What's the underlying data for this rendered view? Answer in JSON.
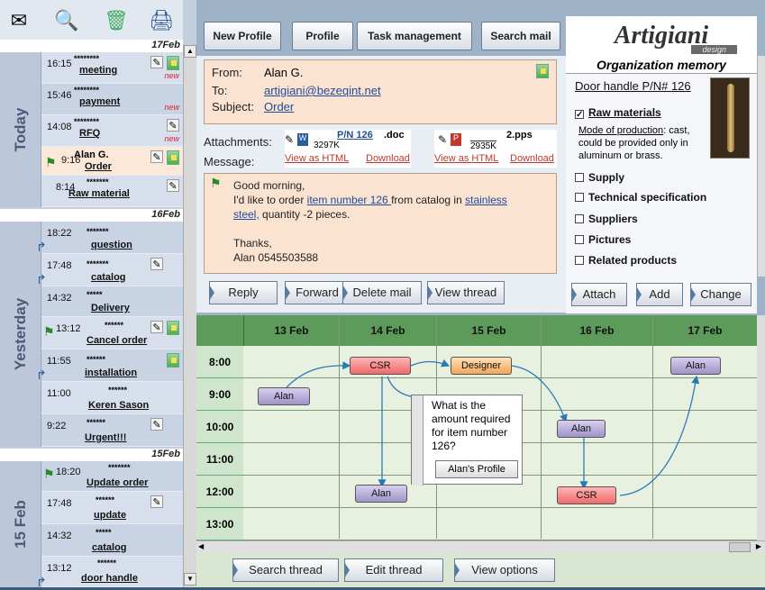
{
  "brand": {
    "name": "Artigiani",
    "sub": "design"
  },
  "toolbar": {
    "new_profile": "New Profile",
    "profile": "Profile",
    "task_management": "Task management",
    "search_mail": "Search mail"
  },
  "sidebar": {
    "day_headers": {
      "d17": "17Feb",
      "d16": "16Feb",
      "d15": "15Feb"
    },
    "day_labels": {
      "today": "Today",
      "yesterday": "Yesterday",
      "feb15": "15 Feb"
    },
    "new_tag": "new",
    "today": [
      {
        "time": "16:15",
        "stars": "********",
        "subject": "meeting"
      },
      {
        "time": "15:46",
        "stars": "********",
        "subject": "payment"
      },
      {
        "time": "14:08",
        "stars": "********",
        "subject": "RFQ"
      },
      {
        "time": "9:16",
        "stars": "Alan G.",
        "subject": "Order"
      },
      {
        "time": "8:14",
        "stars": "*******",
        "subject": "Raw material"
      }
    ],
    "yesterday": [
      {
        "time": "18:22",
        "stars": "*******",
        "subject": "question"
      },
      {
        "time": "17:48",
        "stars": "*******",
        "subject": "catalog"
      },
      {
        "time": "14:32",
        "stars": "*****",
        "subject": "Delivery"
      },
      {
        "time": "13:12",
        "stars": "******",
        "subject": "Cancel order"
      },
      {
        "time": "11:55",
        "stars": "******",
        "subject": "installation"
      },
      {
        "time": "11:00",
        "stars": "******",
        "subject": "Keren Sason"
      },
      {
        "time": "9:22",
        "stars": "******",
        "subject": "Urgent!!!"
      }
    ],
    "feb15": [
      {
        "time": "18:20",
        "stars": "*******",
        "subject": "Update order"
      },
      {
        "time": "17:48",
        "stars": "******",
        "subject": "update"
      },
      {
        "time": "14:32",
        "stars": "*****",
        "subject": "catalog"
      },
      {
        "time": "13:12",
        "stars": "******",
        "subject": "door handle"
      }
    ]
  },
  "mail": {
    "from_label": "From:",
    "from": "Alan G.",
    "to_label": "To:",
    "to": "artigiani@bezeqint.net",
    "subject_label": "Subject:",
    "subject": "Order",
    "attachments_label": "Attachments:",
    "att1": {
      "name": "P/N 126",
      "ext": ".doc",
      "size": "3297K",
      "view": "View as HTML",
      "download": "Download"
    },
    "att2": {
      "name": "",
      "ext": "2.pps",
      "size": "2935K",
      "view": "View as HTML",
      "download": "Download"
    },
    "message_label": "Message:",
    "greeting": "Good morning,",
    "line1a": "I'd like to order ",
    "line1_link": "item number 126 ",
    "line1b": "from catalog in ",
    "line1_link2": "stainless",
    "line2_link": "steel,",
    "line2b": " quantity -2 pieces.",
    "thanks": "Thanks,",
    "sign": "Alan  0545503588"
  },
  "mail_actions": {
    "reply": "Reply",
    "forward": "Forward",
    "delete": "Delete mail",
    "view_thread": "View thread"
  },
  "org": {
    "title": "Organization memory",
    "item": "Door handle  P/N# 126",
    "raw": "Raw materials",
    "mode_label": "Mode of production",
    "mode_text": ": cast, could be provided only in aluminum or brass.",
    "options": [
      "Supply",
      "Technical specification",
      "Suppliers",
      "Pictures",
      "Related products"
    ],
    "attach": "Attach",
    "add": "Add",
    "change": "Change"
  },
  "calendar": {
    "days": [
      "13 Feb",
      "14 Feb",
      "15 Feb",
      "16 Feb",
      "17 Feb"
    ],
    "times": [
      "8:00",
      "9:00",
      "10:00",
      "11:00",
      "12:00",
      "13:00"
    ],
    "events": {
      "csr1": "CSR",
      "designer": "Designer",
      "alan17": "Alan",
      "alan13": "Alan",
      "alan16": "Alan",
      "alan14": "Alan",
      "csr2": "CSR"
    },
    "tooltip": {
      "text": "What is the amount required for item number 126?",
      "button": "Alan's Profile"
    }
  },
  "cal_actions": {
    "search": "Search thread",
    "edit": "Edit thread",
    "options": "View options"
  },
  "colors": {
    "accent": "#5c9b5a",
    "mail_bg": "#fbe3d2",
    "link": "#1f4b99"
  }
}
